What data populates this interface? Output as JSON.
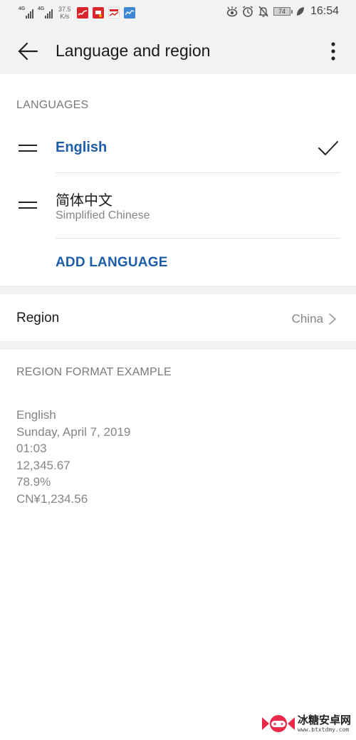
{
  "status_bar": {
    "signal1_label": "4G",
    "signal2_label": "4G",
    "speed_value": "37.5",
    "speed_unit": "K/s",
    "battery": "74",
    "time": "16:54",
    "icons_left": [
      "signal-icon",
      "signal-icon",
      "stock-app-icon",
      "camera-app-icon",
      "chart-app-icon",
      "finance-app-icon"
    ],
    "icons_right": [
      "eye-comfort-icon",
      "alarm-icon",
      "mute-icon",
      "battery-icon",
      "leaf-icon"
    ]
  },
  "app_bar": {
    "title": "Language and region",
    "back_icon": "arrow-left-icon",
    "more_icon": "more-vertical-icon"
  },
  "languages": {
    "header": "LANGUAGES",
    "items": [
      {
        "name": "English",
        "subtitle": "",
        "selected": true,
        "color": "#1e5ea8"
      },
      {
        "name": "简体中文",
        "subtitle": "Simplified Chinese",
        "selected": false
      }
    ],
    "add_label": "ADD LANGUAGE",
    "accent": "#1e5ea8"
  },
  "region": {
    "label": "Region",
    "value": "China"
  },
  "format_example": {
    "header": "REGION FORMAT EXAMPLE",
    "lines": [
      "English",
      "Sunday, April 7, 2019",
      "01:03",
      "12,345.67",
      "78.9%",
      "CN¥1,234.56"
    ]
  },
  "watermark": {
    "title": "冰糖安卓网",
    "url": "www.btxtdmy.com"
  }
}
